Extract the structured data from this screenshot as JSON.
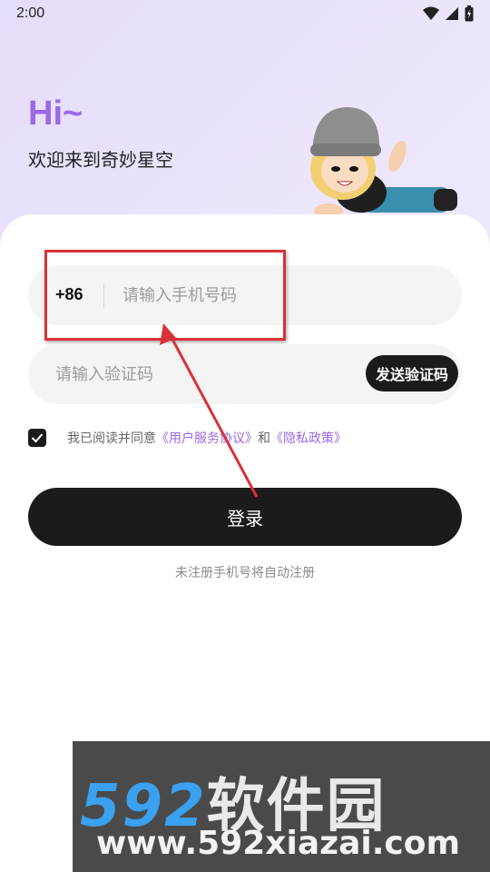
{
  "status_bar": {
    "time": "2:00",
    "icons": [
      "wifi-icon",
      "signal-icon",
      "battery-icon"
    ]
  },
  "header": {
    "greeting": "Hi~",
    "welcome": "欢迎来到奇妙星空"
  },
  "form": {
    "country_code": "+86",
    "phone_placeholder": "请输入手机号码",
    "code_placeholder": "请输入验证码",
    "send_code_label": "发送验证码",
    "agreement": {
      "checked": true,
      "prefix": "我已阅读并同意",
      "terms_link": "《用户服务协议》",
      "conjunction": "和",
      "privacy_link": "《隐私政策》"
    },
    "login_label": "登录",
    "auto_register_hint": "未注册手机号将自动注册"
  },
  "watermark": {
    "brand_number": "592",
    "brand_name": "软件园",
    "url": "www.592xiazai.com"
  },
  "colors": {
    "accent": "#9a69e6",
    "dark": "#1b1b1b",
    "annotation": "#d9313a",
    "field_bg": "#f4f4f4"
  }
}
